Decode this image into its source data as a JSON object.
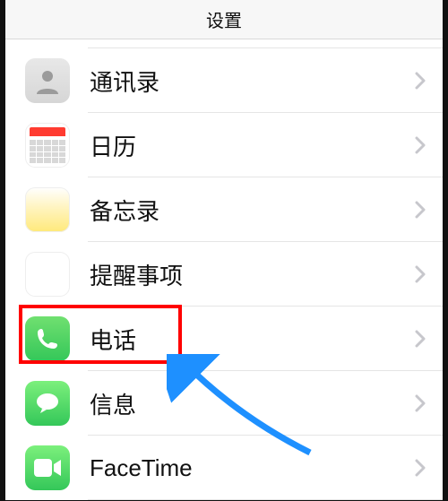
{
  "header": {
    "title": "设置"
  },
  "rows": [
    {
      "id": "contacts",
      "label": "通讯录",
      "icon": "contacts-icon"
    },
    {
      "id": "calendar",
      "label": "日历",
      "icon": "calendar-icon"
    },
    {
      "id": "notes",
      "label": "备忘录",
      "icon": "notes-icon"
    },
    {
      "id": "reminders",
      "label": "提醒事项",
      "icon": "reminders-icon"
    },
    {
      "id": "phone",
      "label": "电话",
      "icon": "phone-icon",
      "highlighted": true
    },
    {
      "id": "messages",
      "label": "信息",
      "icon": "messages-icon"
    },
    {
      "id": "facetime",
      "label": "FaceTime",
      "icon": "facetime-icon"
    }
  ],
  "annotation": {
    "highlight_target": "phone",
    "arrow_color": "#1e90ff"
  }
}
